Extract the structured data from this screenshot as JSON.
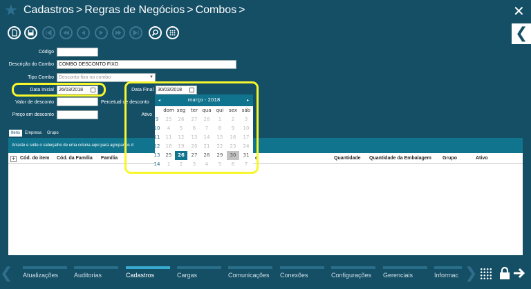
{
  "header": {
    "crumbs": [
      "Cadastros",
      "Regras de Negócios",
      "Combos"
    ],
    "sep": ">",
    "close": "✕"
  },
  "side": {
    "collapse": "❮"
  },
  "form": {
    "codigo_label": "Código",
    "codigo_value": "",
    "descricao_label": "Descrição do Combo",
    "descricao_value": "COMBO DESCONTO FIXO",
    "tipo_label": "Tipo Combo",
    "tipo_value": "Desconto fixo no combo",
    "data_inicial_label": "Data Inicial",
    "data_inicial_value": "26/03/2018",
    "data_final_label": "Data Final",
    "data_final_value": "30/03/2018",
    "valor_label": "Valor de desconto",
    "percentual_label": "Percetual de desconto",
    "ativo_label": "Ativo",
    "preco_label": "Preço em desconto"
  },
  "tabs": [
    "Itens",
    "Empresa",
    "Grupo"
  ],
  "grid": {
    "group_hint": "Arraste e solte o cabeçalho de uma coluna aqui para agrupar os d",
    "expander": "+",
    "columns": [
      "Cód. do item",
      "Cód. da Família",
      "Família",
      "o",
      "Quantidade",
      "Quantidade da Embalagem",
      "Grupo",
      "Ativo"
    ]
  },
  "calendar": {
    "title": "março - 2018",
    "prev": "◂",
    "next": "▸",
    "dow": [
      "dom",
      "seg",
      "ter",
      "qua",
      "qui",
      "sex",
      "sáb"
    ],
    "weeks": [
      "9",
      "10",
      "11",
      "12",
      "13",
      "14"
    ],
    "days": [
      [
        "25",
        "26",
        "27",
        "28",
        "1",
        "2",
        "3"
      ],
      [
        "4",
        "5",
        "6",
        "7",
        "8",
        "9",
        "10"
      ],
      [
        "11",
        "12",
        "13",
        "14",
        "15",
        "16",
        "17"
      ],
      [
        "18",
        "19",
        "20",
        "21",
        "22",
        "23",
        "24"
      ],
      [
        "25",
        "26",
        "27",
        "28",
        "29",
        "30",
        "31"
      ],
      [
        "1",
        "2",
        "3",
        "4",
        "5",
        "6",
        "7"
      ]
    ]
  },
  "bottom_nav": [
    "Atualizações",
    "Auditorias",
    "Cadastros",
    "Cargas",
    "Comunicações",
    "Conexões",
    "Configurações",
    "Gerenciais",
    "Informac"
  ],
  "bottom_nav_active": "Cadastros",
  "colors": {
    "background": "#154f66",
    "accent": "#10748e",
    "highlight": "#f7f72c"
  }
}
